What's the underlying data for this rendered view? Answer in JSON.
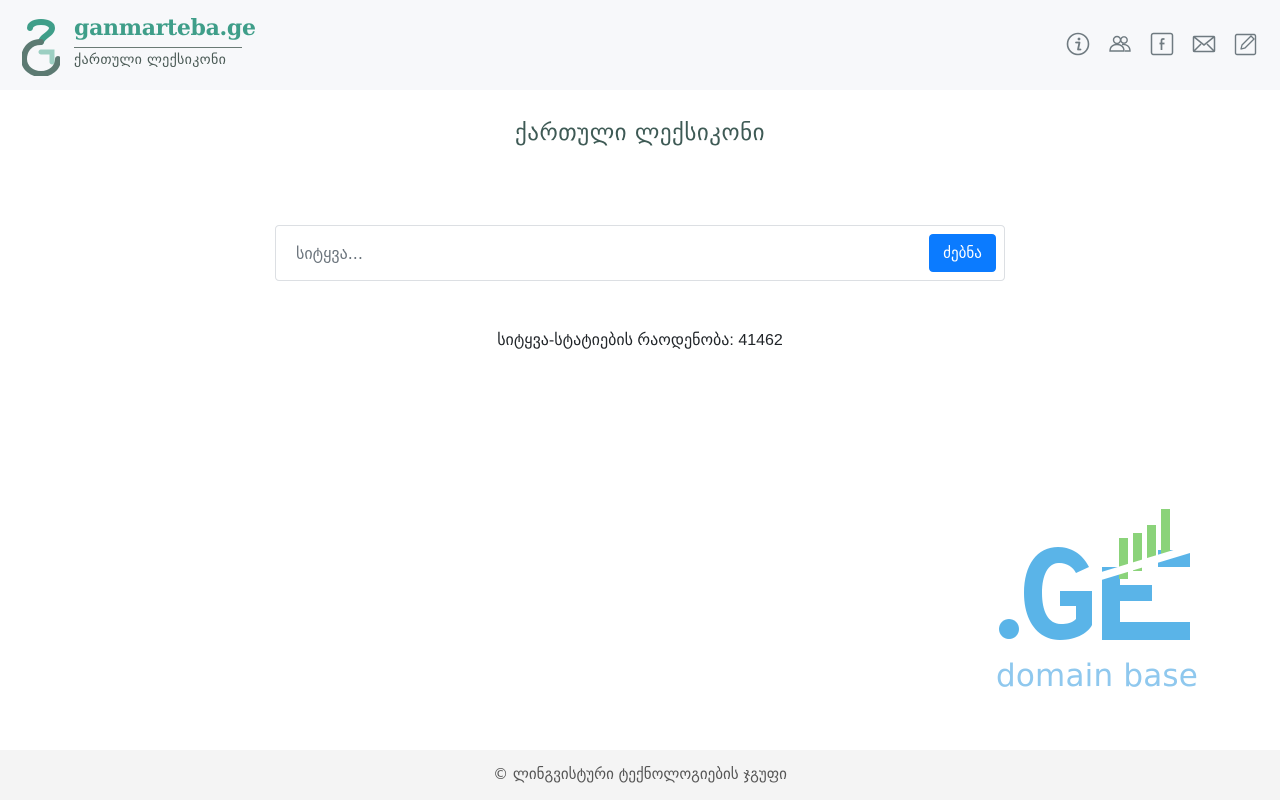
{
  "header": {
    "logo_name": "ganmarteba.ge",
    "logo_subtitle": "ქართული ლექსიკონი",
    "icons": [
      "info-icon",
      "users-icon",
      "facebook-icon",
      "mail-icon",
      "edit-icon"
    ]
  },
  "main": {
    "title": "ქართული ლექსიკონი",
    "search": {
      "placeholder": "სიტყვა...",
      "value": "",
      "button_label": "ძებნა"
    },
    "word_count_text": "სიტყვა-სტატიების რაოდენობა: 41462"
  },
  "promo": {
    "logo_text": ".GE",
    "caption": "domain base"
  },
  "footer": {
    "text": "© ლინგვისტური ტექნოლოგიების ჯგუფი"
  },
  "colors": {
    "brand_green": "#3f9e89",
    "button_blue": "#0b7bff",
    "ge_blue": "#5ab4e8",
    "ge_green": "#8bd37a"
  }
}
